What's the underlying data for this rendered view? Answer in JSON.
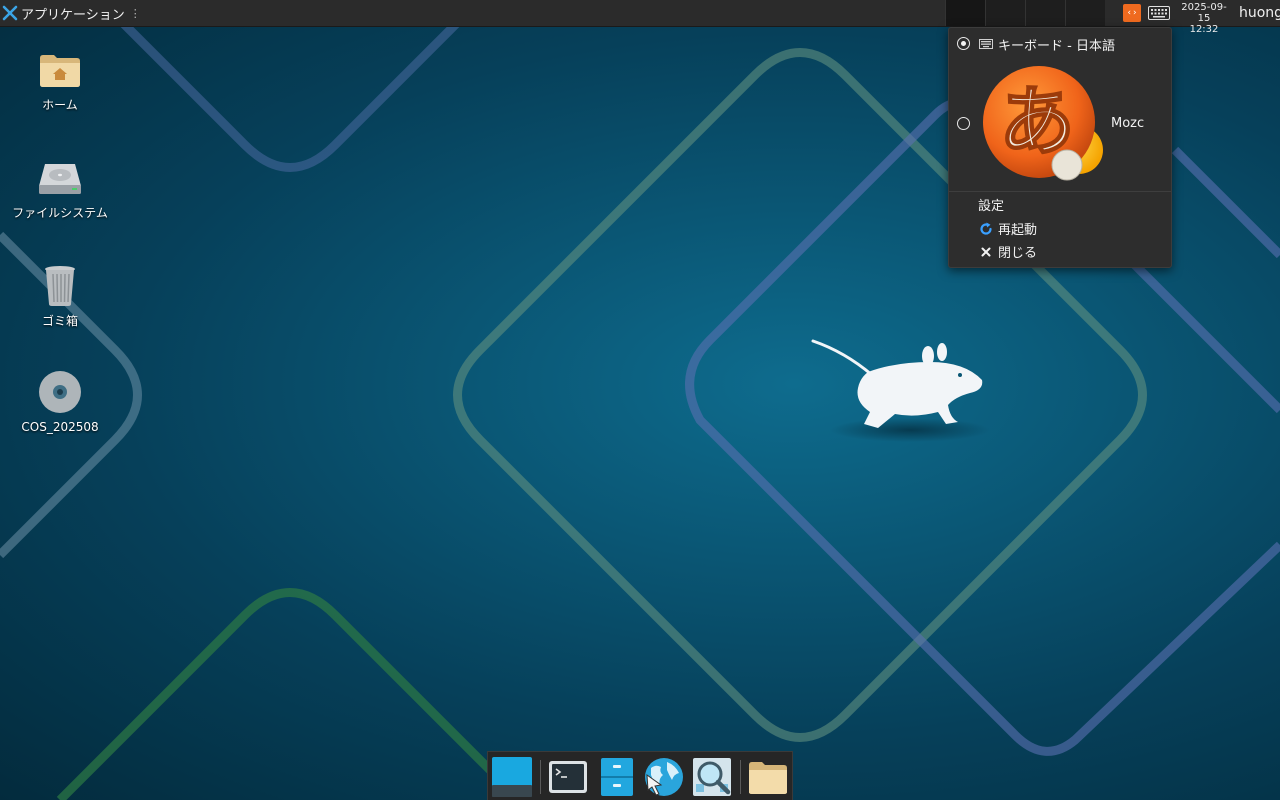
{
  "top_panel": {
    "app_menu_label": "アプリケーション",
    "app_menu_more": "⋮",
    "clock_date": "2025-09-15",
    "clock_time": "12:32",
    "user": "huong"
  },
  "desktop_icons": [
    {
      "label": "ホーム",
      "icon": "home-folder-icon"
    },
    {
      "label": "ファイルシステム",
      "icon": "hard-drive-icon"
    },
    {
      "label": "ゴミ箱",
      "icon": "trash-icon"
    },
    {
      "label": "COS_202508",
      "icon": "optical-disc-icon"
    }
  ],
  "input_method_menu": {
    "items": [
      {
        "label": "キーボード - 日本語",
        "selected": true,
        "icon": "keyboard-icon"
      },
      {
        "label": "Mozc",
        "selected": false,
        "icon": "mozc-icon",
        "icon_text": "あ"
      }
    ],
    "settings_label": "設定",
    "restart_label": "再起動",
    "close_label": "閉じる"
  },
  "dock": {
    "items": [
      "show-desktop-icon",
      "terminal-icon",
      "file-manager-icon",
      "web-browser-icon",
      "app-finder-icon",
      "folder-icon"
    ]
  },
  "colors": {
    "panel_bg": "#2b2b2b",
    "menu_bg": "#2d2d2d",
    "mozc_orange": "#ef6a1f",
    "accent_blue": "#1fa3de"
  }
}
